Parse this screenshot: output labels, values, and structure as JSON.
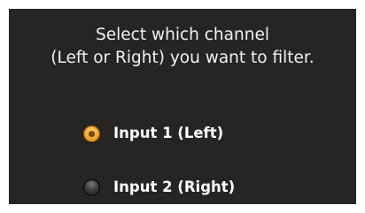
{
  "instruction": {
    "line1": "Select which channel",
    "line2": "(Left or Right) you want to filter."
  },
  "options": [
    {
      "label": "Input 1 (Left)",
      "selected": true,
      "icon": "radio-selected-icon"
    },
    {
      "label": "Input 2 (Right)",
      "selected": false,
      "icon": "radio-unselected-icon"
    }
  ],
  "colors": {
    "panel_background": "#262523",
    "text": "#ffffff",
    "radio_selected": "#f6a934",
    "radio_unselected": "#1a1a1a"
  }
}
